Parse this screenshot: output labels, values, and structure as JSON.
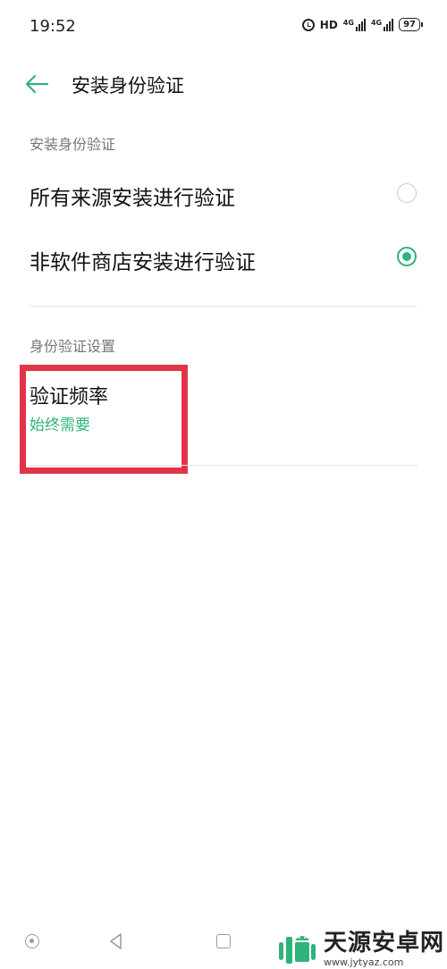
{
  "status_bar": {
    "time": "19:52",
    "hd_label": "HD",
    "network_1": "4G",
    "network_2": "4G",
    "battery": "97"
  },
  "header": {
    "title": "安装身份验证"
  },
  "sections": {
    "install_verify": {
      "header": "安装身份验证",
      "options": [
        {
          "label": "所有来源安装进行验证",
          "selected": false
        },
        {
          "label": "非软件商店安装进行验证",
          "selected": true
        }
      ]
    },
    "verify_settings": {
      "header": "身份验证设置",
      "frequency_title": "验证频率",
      "frequency_value": "始终需要"
    }
  },
  "watermark": {
    "name": "天源安卓网",
    "url": "www.jytyaz.com"
  },
  "colors": {
    "accent": "#2fb37b",
    "highlight": "#e23447"
  }
}
